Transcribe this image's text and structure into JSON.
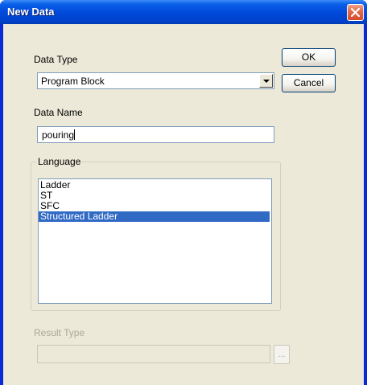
{
  "window": {
    "title": "New Data"
  },
  "data_type": {
    "label": "Data Type",
    "value": "Program Block"
  },
  "data_name": {
    "label": "Data Name",
    "value": "pouring"
  },
  "language": {
    "label": "Language",
    "items": [
      "Ladder",
      "ST",
      "SFC",
      "Structured Ladder"
    ],
    "selected": "Structured Ladder"
  },
  "result_type": {
    "label": "Result Type",
    "value": "",
    "browse_label": "..."
  },
  "buttons": {
    "ok": "OK",
    "cancel": "Cancel"
  },
  "colors": {
    "titlebar": "#0054e3",
    "dialog_bg": "#ece9d8",
    "selection": "#316ac5",
    "close_button": "#d64a2c",
    "disabled_text": "#aca899"
  },
  "icons": {
    "close": "close-icon",
    "dropdown": "chevron-down-icon"
  }
}
